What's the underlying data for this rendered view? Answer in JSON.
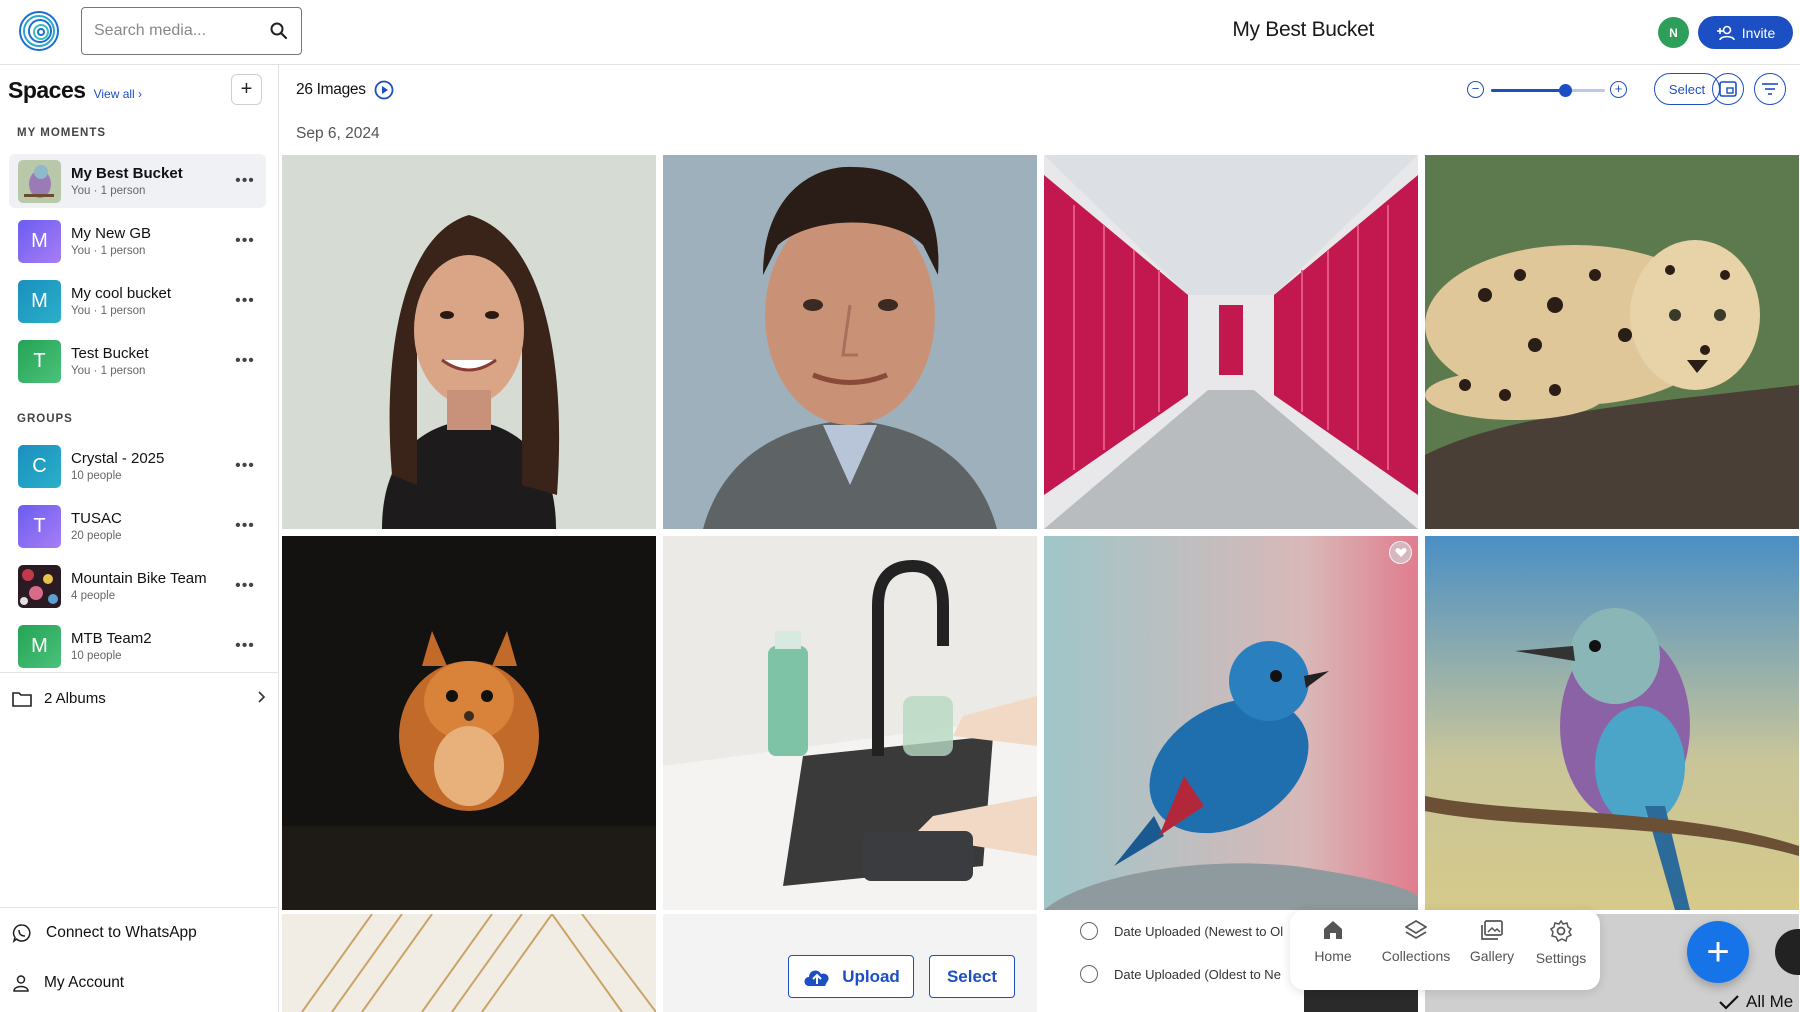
{
  "header": {
    "search_placeholder": "Search media...",
    "bucket_title": "My Best Bucket",
    "user_initial": "N",
    "invite_label": "Invite"
  },
  "sidebar": {
    "title": "Spaces",
    "view_all": "View all ›",
    "my_moments_label": "MY MOMENTS",
    "groups_label": "GROUPS",
    "moments": [
      {
        "name": "My Best Bucket",
        "sub": "You · 1 person",
        "initial": "",
        "color": "#8e6a9a"
      },
      {
        "name": "My New GB",
        "sub": "You · 1 person",
        "initial": "M",
        "color": "#7b6cf0"
      },
      {
        "name": "My cool bucket",
        "sub": "You · 1 person",
        "initial": "M",
        "color": "#1f9bc2"
      },
      {
        "name": "Test Bucket",
        "sub": "You · 1 person",
        "initial": "T",
        "color": "#2eaa5c"
      }
    ],
    "groups": [
      {
        "name": "Crystal - 2025",
        "sub": "10 people",
        "initial": "C",
        "color": "#1f9bc2"
      },
      {
        "name": "TUSAC",
        "sub": "20 people",
        "initial": "T",
        "color": "#7b6cf0"
      },
      {
        "name": "Mountain Bike Team",
        "sub": "4 people",
        "initial": "",
        "color": "#4a2a3a"
      },
      {
        "name": "MTB Team2",
        "sub": "10 people",
        "initial": "M",
        "color": "#2eaa5c"
      }
    ],
    "albums": "2 Albums",
    "whatsapp": "Connect to WhatsApp",
    "account": "My Account"
  },
  "toolbar": {
    "image_count": "26 Images",
    "zoom_level": 0.65,
    "select_label": "Select"
  },
  "gallery": {
    "date": "Sep 6, 2024",
    "photos": [
      "woman-portrait-icon",
      "man-portrait-icon",
      "storage-hallway-icon",
      "leopard-icon",
      "squirrel-icon",
      "sink-cleaning-icon",
      "blue-bird-icon",
      "lilac-roller-bird-icon"
    ]
  },
  "upload": {
    "upload_label": "Upload",
    "select_label": "Select"
  },
  "sort": {
    "option_1": "Date Uploaded (Newest to Ol",
    "option_2": "Date Uploaded (Oldest to Ne"
  },
  "bottom_nav": {
    "home": "Home",
    "collections": "Collections",
    "gallery": "Gallery",
    "settings": "Settings"
  },
  "overlay": {
    "all_me": "All Me"
  },
  "colors": {
    "accent": "#1d4fc4",
    "fab": "#1773e8"
  }
}
